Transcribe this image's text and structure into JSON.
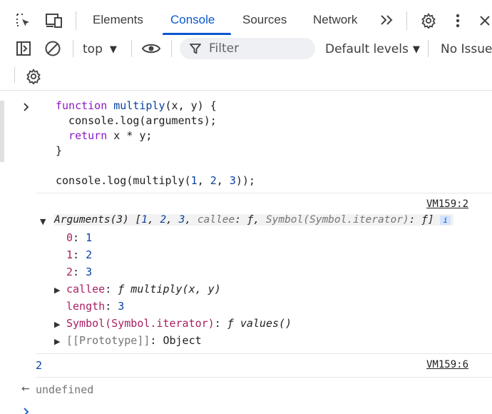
{
  "tabs": {
    "items": [
      "Elements",
      "Console",
      "Sources",
      "Network"
    ],
    "active": "Console",
    "more": ">>"
  },
  "toolbar": {
    "context": "top",
    "filter_placeholder": "Filter",
    "levels": "Default levels",
    "issues": "No Issues"
  },
  "console": {
    "input": {
      "l1a": "function",
      "l1b": " multiply",
      "l1c": "(x, y) {",
      "l2": "  console.log(arguments);",
      "l3a": "  return",
      "l3b": " x * y;",
      "l4": "}",
      "l6a": "console.log(multiply(",
      "l6b": "1",
      "l6c": ", ",
      "l6d": "2",
      "l6e": ", ",
      "l6f": "3",
      "l6g": "));"
    },
    "entry1": {
      "source": "VM159:2",
      "summary_a": "Arguments(3) [",
      "summary_n1": "1",
      "summary_n2": "2",
      "summary_n3": "3",
      "summary_rest1": "callee",
      "summary_rest2": ": ƒ, ",
      "summary_rest3": "Symbol(Symbol.iterator)",
      "summary_rest4": ": ƒ]",
      "info": "i",
      "items": [
        {
          "key": "0",
          "value": "1"
        },
        {
          "key": "1",
          "value": "2"
        },
        {
          "key": "2",
          "value": "3"
        }
      ],
      "callee_key": "callee",
      "callee_val": "ƒ multiply(x, y)",
      "length_key": "length",
      "length_val": "3",
      "iter_key": "Symbol(Symbol.iterator)",
      "iter_val": "ƒ values()",
      "proto_key": "[[Prototype]]",
      "proto_val": "Object"
    },
    "entry2": {
      "value": "2",
      "source": "VM159:6"
    },
    "result": "undefined"
  }
}
